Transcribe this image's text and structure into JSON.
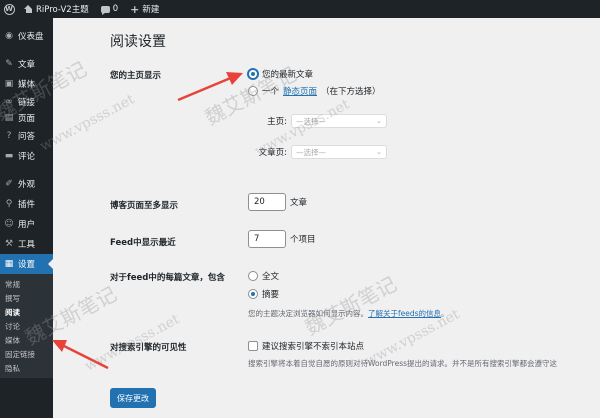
{
  "adminbar": {
    "site_name": "RiPro-V2主题",
    "comments_count": "0",
    "new_label": "新建"
  },
  "sidebar": {
    "items": [
      {
        "label": "仪表盘",
        "icon": "dashboard-icon"
      },
      {
        "label": "文章",
        "icon": "pin-icon"
      },
      {
        "label": "媒体",
        "icon": "media-icon"
      },
      {
        "label": "链接",
        "icon": "link-icon"
      },
      {
        "label": "页面",
        "icon": "page-icon"
      },
      {
        "label": "问答",
        "icon": "question-icon"
      },
      {
        "label": "评论",
        "icon": "comment-icon"
      },
      {
        "label": "外观",
        "icon": "brush-icon"
      },
      {
        "label": "插件",
        "icon": "plugin-icon"
      },
      {
        "label": "用户",
        "icon": "user-icon"
      },
      {
        "label": "工具",
        "icon": "wrench-icon"
      },
      {
        "label": "设置",
        "icon": "settings-icon"
      }
    ],
    "submenu": [
      "常规",
      "撰写",
      "阅读",
      "讨论",
      "媒体",
      "固定链接",
      "隐私"
    ]
  },
  "page": {
    "title": "阅读设置"
  },
  "settings": {
    "homepage_label": "您的主页显示",
    "option_latest": "您的最新文章",
    "option_static_prefix": "一个",
    "option_static_link": "静态页面",
    "option_static_suffix": "（在下方选择）",
    "homepage_select_label": "主页:",
    "posts_page_select_label": "文章页:",
    "select_placeholder": "—选择—",
    "posts_per_page_label": "博客页面至多显示",
    "posts_per_page_value": "20",
    "posts_per_page_unit": "文章",
    "feed_items_label": "Feed中显示最近",
    "feed_items_value": "7",
    "feed_items_unit": "个项目",
    "feed_content_label": "对于feed中的每篇文章，包含",
    "feed_full": "全文",
    "feed_summary": "摘要",
    "feed_desc_prefix": "您的主题决定浏览器如何显示内容。",
    "feed_desc_link": "了解关于feeds的信息",
    "feed_desc_suffix": "。",
    "visibility_label": "对搜索引擎的可见性",
    "visibility_checkbox": "建议搜索引擎不索引本站点",
    "visibility_desc": "搜索引擎将本着自觉自愿的原则对待WordPress提出的请求。并不是所有搜索引擎都会遵守这",
    "save_button": "保存更改"
  },
  "watermark": {
    "text": "魏艾斯笔记",
    "url": "www.vpsss.net"
  },
  "colors": {
    "primary": "#2271b1",
    "sidebar_bg": "#1d2327",
    "arrow": "#e8433a"
  }
}
